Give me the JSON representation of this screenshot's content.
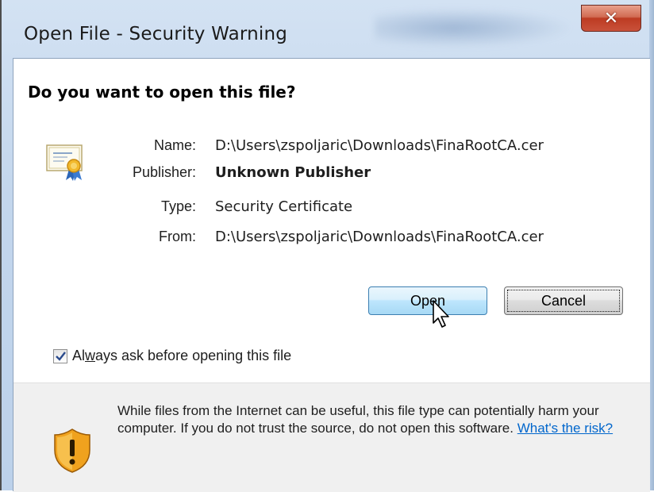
{
  "window": {
    "title": "Open File - Security Warning",
    "close_glyph": "✕"
  },
  "dialog": {
    "question": "Do you want to open this file?",
    "icon": "certificate-icon",
    "fields": [
      {
        "label": "Name:",
        "value": "D:\\Users\\zspoljaric\\Downloads\\FinaRootCA.cer",
        "bold": false
      },
      {
        "label": "Publisher:",
        "value": "Unknown Publisher",
        "bold": true
      },
      {
        "label": "Type:",
        "value": "Security Certificate",
        "bold": false
      },
      {
        "label": "From:",
        "value": "D:\\Users\\zspoljaric\\Downloads\\FinaRootCA.cer",
        "bold": false
      }
    ],
    "buttons": {
      "open_label": "Open",
      "cancel_label": "Cancel"
    },
    "checkbox": {
      "checked": true,
      "label_prefix": "Al",
      "label_underlined": "w",
      "label_suffix": "ays ask before opening this file"
    }
  },
  "footer": {
    "icon": "shield-warning-icon",
    "warning_text": "While files from the Internet can be useful, this file type can potentially harm your computer. If you do not trust the source, do not open this software. ",
    "risk_link": "What's the risk?"
  },
  "colors": {
    "link": "#0066cc",
    "close_button": "#c9513a",
    "footer_bg": "#f0f0f0"
  }
}
